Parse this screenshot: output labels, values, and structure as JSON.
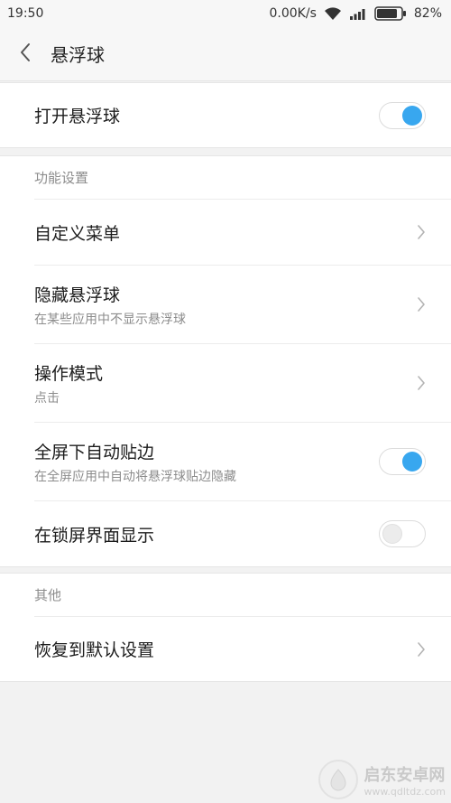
{
  "status_bar": {
    "time": "19:50",
    "network_speed": "0.00K/s",
    "battery": "82%"
  },
  "header": {
    "title": "悬浮球"
  },
  "main_toggle": {
    "label": "打开悬浮球",
    "state": "on"
  },
  "function_settings": {
    "header": "功能设置",
    "items": [
      {
        "label": "自定义菜单",
        "control": "chevron"
      },
      {
        "label": "隐藏悬浮球",
        "sub": "在某些应用中不显示悬浮球",
        "control": "chevron"
      },
      {
        "label": "操作模式",
        "sub": "点击",
        "control": "chevron"
      },
      {
        "label": "全屏下自动贴边",
        "sub": "在全屏应用中自动将悬浮球贴边隐藏",
        "control": "switch",
        "state": "on"
      },
      {
        "label": "在锁屏界面显示",
        "control": "switch",
        "state": "off"
      }
    ]
  },
  "other": {
    "header": "其他",
    "items": [
      {
        "label": "恢复到默认设置",
        "control": "chevron"
      }
    ]
  },
  "watermark": {
    "name": "启东安卓网",
    "url": "www.qdltdz.com"
  },
  "colors": {
    "accent": "#38a7ef",
    "background": "#f2f2f2",
    "card": "#ffffff",
    "secondary_text": "#8c8c8c"
  }
}
